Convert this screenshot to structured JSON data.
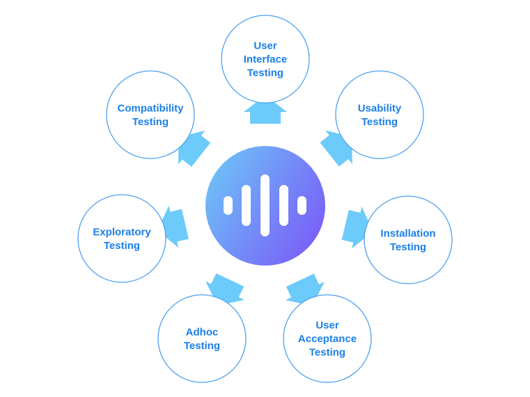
{
  "diagram": {
    "type": "hub-and-spoke",
    "colors": {
      "node_text": "#1a7fe6",
      "node_border": "#4a9ff0",
      "arrow": "#6ccbfa",
      "hub_gradient_start": "#6ec3f7",
      "hub_gradient_end": "#7a5cf9",
      "hub_icon": "#ffffff"
    },
    "hub": {
      "icon": "sound-wave-icon"
    },
    "nodes": [
      {
        "id": "user-interface-testing",
        "lines": [
          "User",
          "Interface",
          "Testing"
        ]
      },
      {
        "id": "usability-testing",
        "lines": [
          "Usability",
          "Testing"
        ]
      },
      {
        "id": "installation-testing",
        "lines": [
          "Installation",
          "Testing"
        ]
      },
      {
        "id": "user-acceptance-testing",
        "lines": [
          "User",
          "Acceptance",
          "Testing"
        ]
      },
      {
        "id": "adhoc-testing",
        "lines": [
          "Adhoc",
          "Testing"
        ]
      },
      {
        "id": "exploratory-testing",
        "lines": [
          "Exploratory",
          "Testing"
        ]
      },
      {
        "id": "compatibility-testing",
        "lines": [
          "Compatibility",
          "Testing"
        ]
      }
    ]
  }
}
